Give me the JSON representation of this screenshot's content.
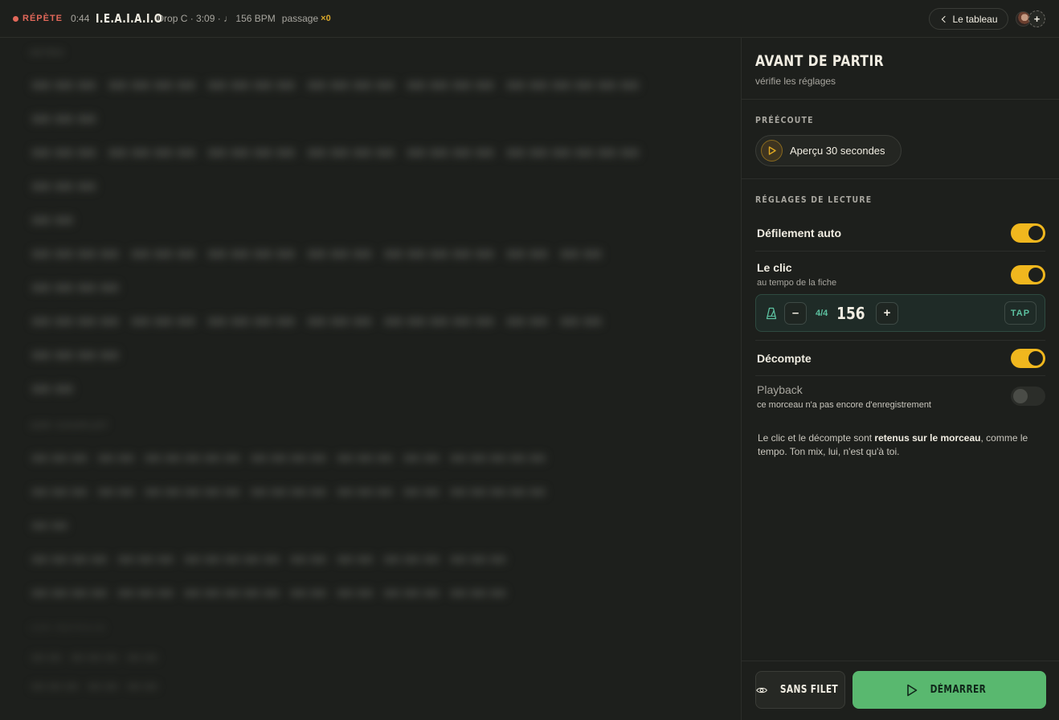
{
  "topbar": {
    "status_label": "RÉPÈTE",
    "elapsed": "0:44",
    "song_title": "I.E.A.I.A.I.O",
    "song_meta": "Drop C · 3:09 · ♩ 156 BPM",
    "pass_label": "passage",
    "pass_count": "×0",
    "back_label": "Le tableau",
    "add_collaborator_symbol": "+",
    "status_color": "#e2685a"
  },
  "lyrics": {
    "sections": [
      {
        "label": "INTRO"
      },
      {
        "label": "1ER COUPLET"
      },
      {
        "label": "1ER REFRAIN"
      }
    ]
  },
  "panel": {
    "title": "AVANT DE PARTIR",
    "subtitle": "vérifie les réglages",
    "preview_section_label": "PRÉÉCOUTE",
    "preview_button_label": "Aperçu 30 secondes",
    "settings_section_label": "RÉGLAGES DE LECTURE",
    "settings": [
      {
        "label": "Défilement auto",
        "sub": "",
        "on": true
      },
      {
        "label": "Le clic",
        "sub": "au tempo de la fiche",
        "on": true
      },
      {
        "label": "Décompte",
        "sub": "",
        "on": true
      },
      {
        "label": "Playback",
        "sub": "ce morceau n'a pas encore d'enregistrement",
        "on": false
      }
    ],
    "metronome": {
      "decrement_symbol": "–",
      "time_signature": "4/4",
      "bpm": "156",
      "increment_symbol": "+",
      "tap_label": "TAP"
    },
    "note_part1": "Le clic et le décompte sont ",
    "note_bold": "retenus sur le morceau",
    "note_part2": ", comme le tempo. Ton mix, lui, n'est qu'à toi."
  },
  "footer": {
    "no_net_label": "SANS FILET",
    "start_label": "DÉMARRER",
    "accent_color": "#59b86f",
    "toggle_color": "#f0b71e"
  }
}
